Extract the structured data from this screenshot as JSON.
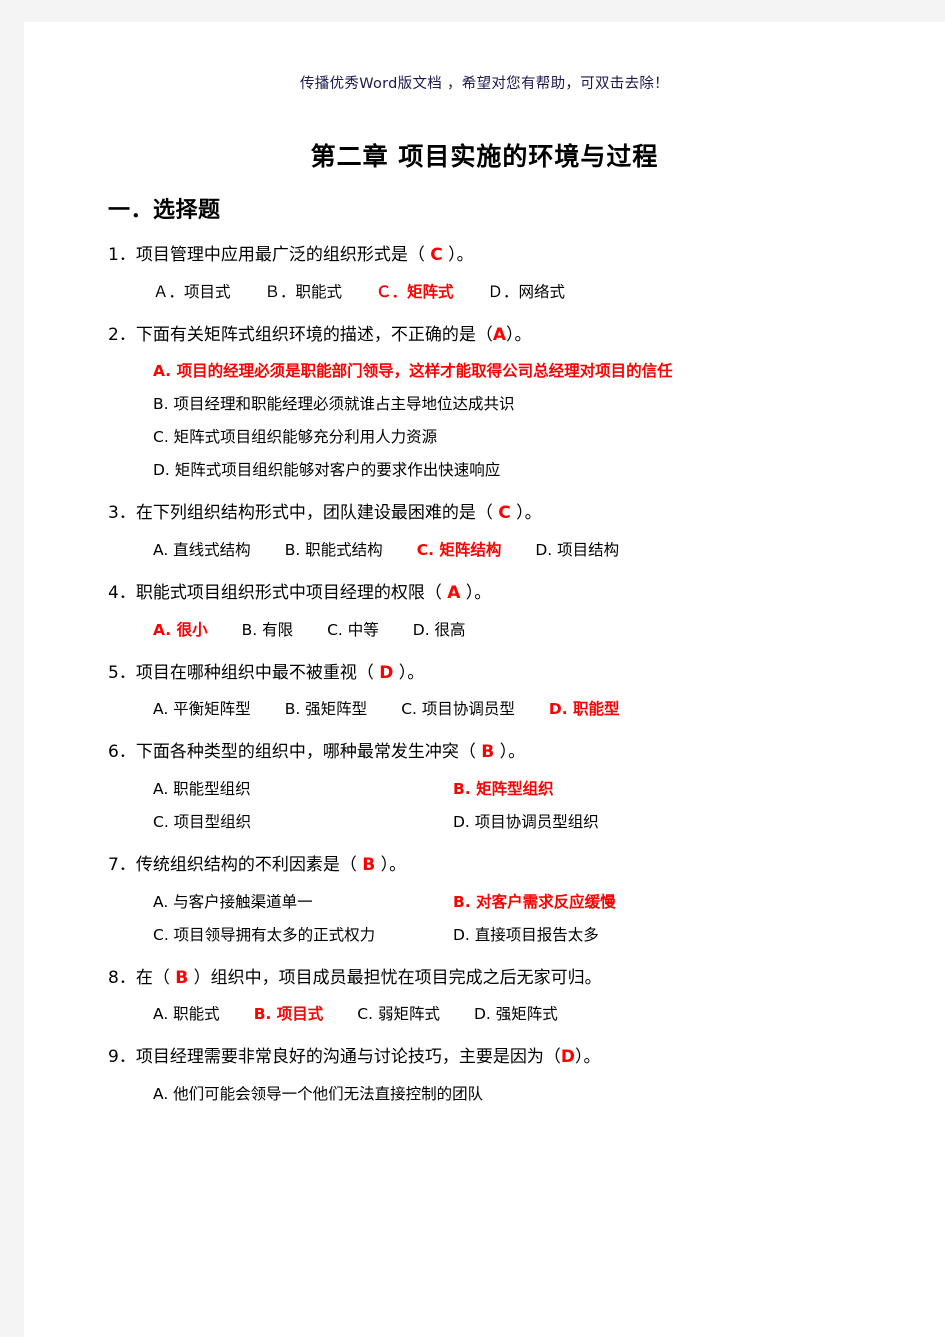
{
  "watermark": "传播优秀Word版文档 ，希望对您有帮助，可双击去除！",
  "title": "第二章   项目实施的环境与过程",
  "section": {
    "heading": "一．选择题"
  },
  "questions": [
    {
      "number": "1．",
      "stem_before": "项目管理中应用最广泛的组织形式是（ ",
      "answer": "C",
      "stem_after": " ）。",
      "layout": "inline",
      "options": [
        {
          "label": "Ａ．项目式",
          "red": false
        },
        {
          "label": "Ｂ．职能式",
          "red": false
        },
        {
          "label": "Ｃ．矩阵式",
          "red": true
        },
        {
          "label": "Ｄ．网络式",
          "red": false
        }
      ]
    },
    {
      "number": "2．",
      "stem_before": "下面有关矩阵式组织环境的描述，不正确的是（",
      "answer": "A",
      "stem_after": "）。",
      "layout": "stacked",
      "options": [
        {
          "label": "A. 项目的经理必须是职能部门领导，这样才能取得公司总经理对项目的信任",
          "red": true
        },
        {
          "label": "B. 项目经理和职能经理必须就谁占主导地位达成共识",
          "red": false
        },
        {
          "label": "C. 矩阵式项目组织能够充分利用人力资源",
          "red": false
        },
        {
          "label": "D. 矩阵式项目组织能够对客户的要求作出快速响应",
          "red": false
        }
      ]
    },
    {
      "number": "3．",
      "stem_before": "在下列组织结构形式中，团队建设最困难的是（ ",
      "answer": "C",
      "stem_after": " ）。",
      "layout": "inline",
      "options": [
        {
          "label": "A. 直线式结构",
          "red": false
        },
        {
          "label": "B. 职能式结构",
          "red": false
        },
        {
          "label": "C. 矩阵结构",
          "red": true
        },
        {
          "label": "D. 项目结构",
          "red": false
        }
      ]
    },
    {
      "number": "4．",
      "stem_before": "职能式项目组织形式中项目经理的权限（ ",
      "answer": "A",
      "stem_after": " ）。",
      "layout": "inline",
      "options": [
        {
          "label": "A. 很小",
          "red": true
        },
        {
          "label": "B. 有限",
          "red": false
        },
        {
          "label": "C. 中等",
          "red": false
        },
        {
          "label": "D. 很高",
          "red": false
        }
      ]
    },
    {
      "number": "5．",
      "stem_before": "项目在哪种组织中最不被重视（ ",
      "answer": "D",
      "stem_after": " ）。",
      "layout": "inline",
      "options": [
        {
          "label": "A. 平衡矩阵型",
          "red": false
        },
        {
          "label": "B. 强矩阵型",
          "red": false
        },
        {
          "label": "C. 项目协调员型",
          "red": false
        },
        {
          "label": "D. 职能型",
          "red": true
        }
      ]
    },
    {
      "number": "6．",
      "stem_before": "下面各种类型的组织中，哪种最常发生冲突（ ",
      "answer": "B",
      "stem_after": " ）。",
      "layout": "twocol",
      "options": [
        {
          "label": "A. 职能型组织",
          "red": false
        },
        {
          "label": "B. 矩阵型组织",
          "red": true
        },
        {
          "label": "C. 项目型组织",
          "red": false
        },
        {
          "label": "D. 项目协调员型组织",
          "red": false
        }
      ]
    },
    {
      "number": "7．",
      "stem_before": "传统组织结构的不利因素是（ ",
      "answer": "B",
      "stem_after": " ）。",
      "layout": "twocol",
      "options": [
        {
          "label": "A. 与客户接触渠道单一",
          "red": false
        },
        {
          "label": "B. 对客户需求反应缓慢",
          "red": true
        },
        {
          "label": "C. 项目领导拥有太多的正式权力",
          "red": false
        },
        {
          "label": "D. 直接项目报告太多",
          "red": false
        }
      ]
    },
    {
      "number": "8．",
      "stem_before": "在（ ",
      "answer": "B",
      "stem_after": " ）组织中，项目成员最担忧在项目完成之后无家可归。",
      "layout": "inline",
      "options": [
        {
          "label": "A. 职能式",
          "red": false
        },
        {
          "label": "B. 项目式",
          "red": true
        },
        {
          "label": "C. 弱矩阵式",
          "red": false
        },
        {
          "label": "D. 强矩阵式",
          "red": false
        }
      ]
    },
    {
      "number": "9．",
      "stem_before": "项目经理需要非常良好的沟通与讨论技巧，主要是因为（",
      "answer": "D",
      "stem_after": "）。",
      "layout": "stacked",
      "options": [
        {
          "label": "A. 他们可能会领导一个他们无法直接控制的团队",
          "red": false
        }
      ]
    }
  ]
}
